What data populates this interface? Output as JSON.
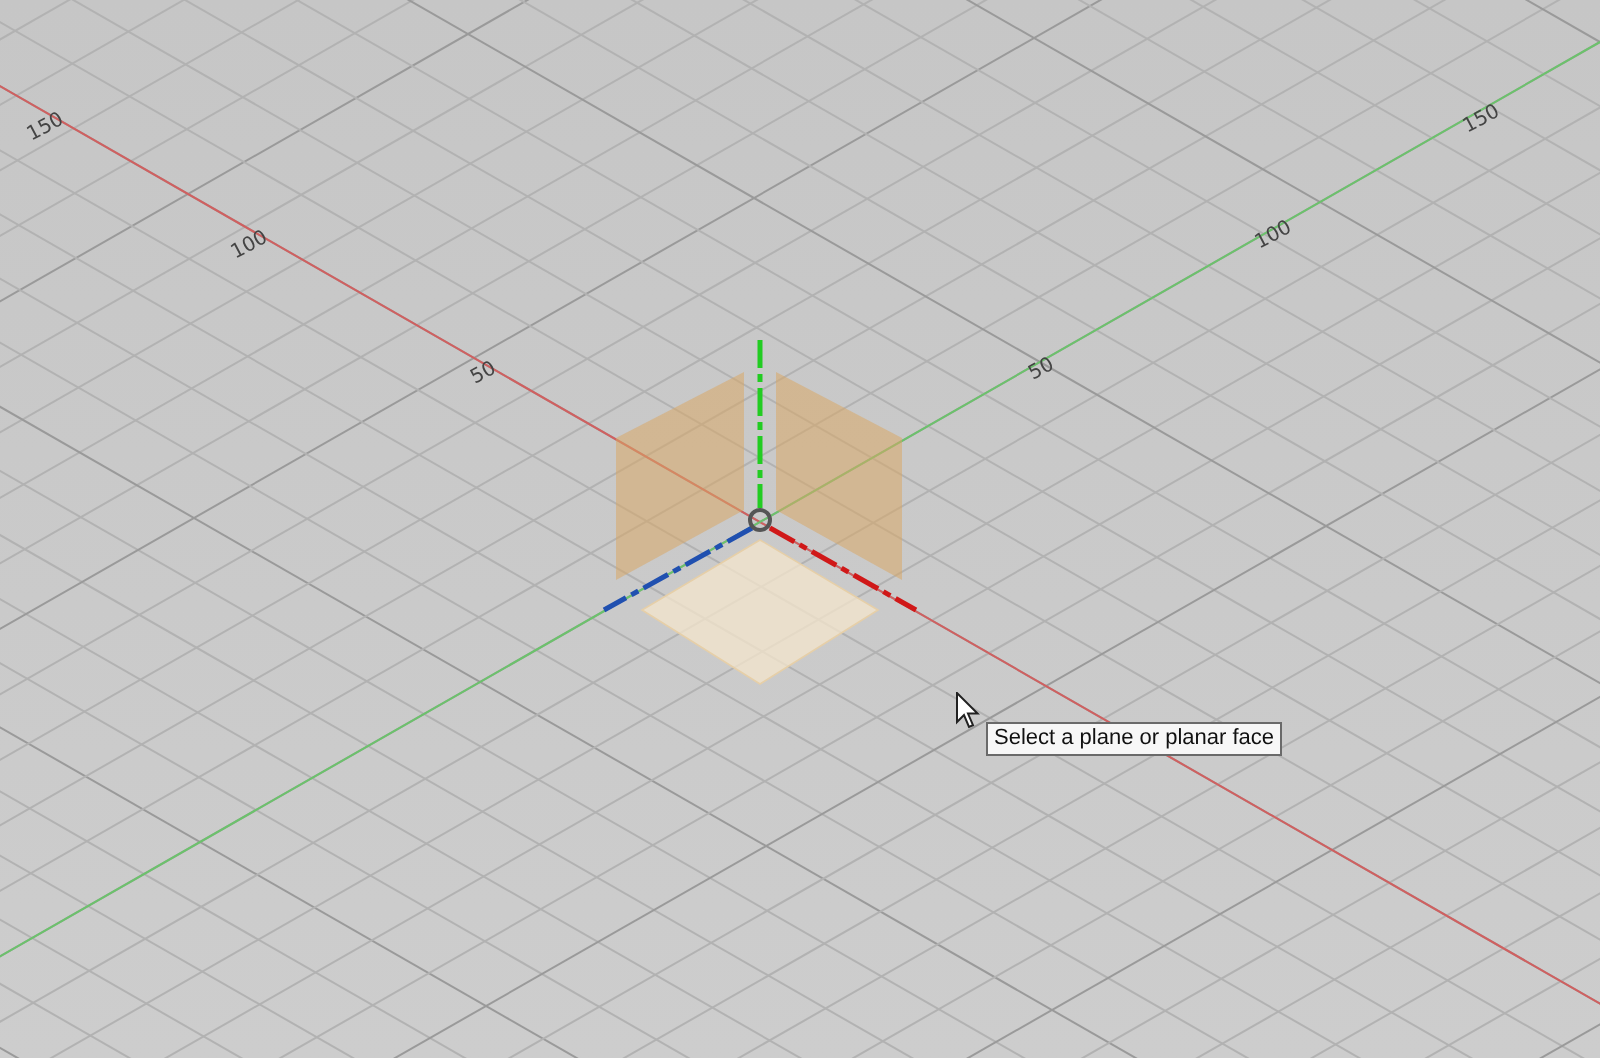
{
  "viewport": {
    "red_axis_labels": [
      "150",
      "100",
      "50"
    ],
    "green_axis_labels": [
      "50",
      "100",
      "150"
    ]
  },
  "tooltip": {
    "text": "Select a plane or planar face"
  }
}
